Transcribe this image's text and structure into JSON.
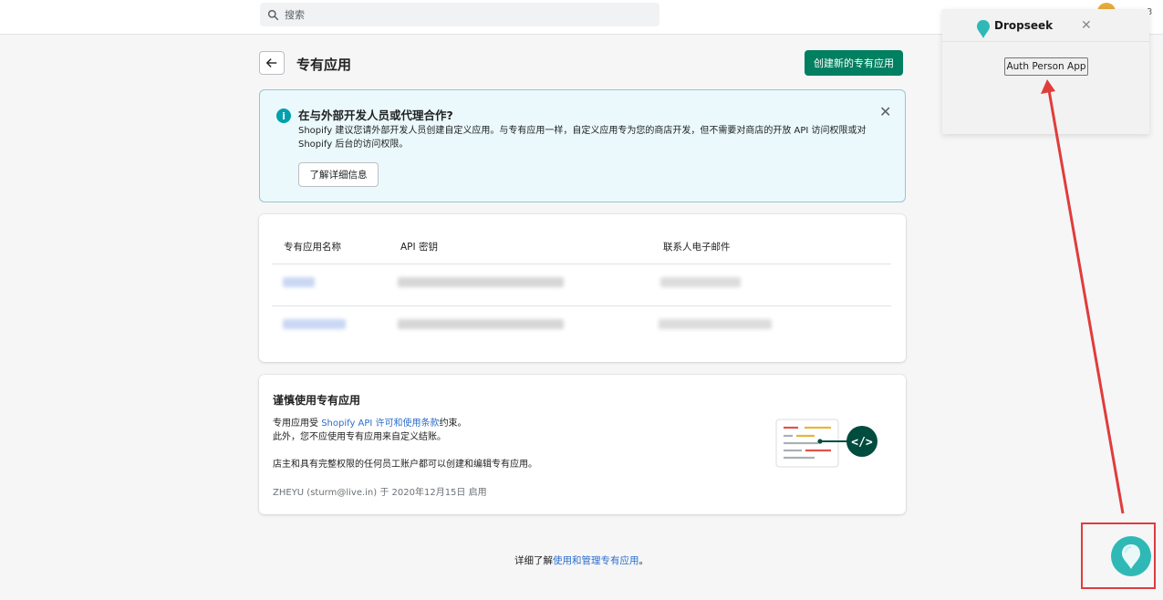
{
  "topbar": {
    "search_placeholder": "搜索",
    "avatar_trail": "3"
  },
  "header": {
    "title": "专有应用",
    "create_button": "创建新的专有应用"
  },
  "banner": {
    "title": "在与外部开发人员或代理合作?",
    "body": "Shopify 建议您请外部开发人员创建自定义应用。与专有应用一样，自定义应用专为您的商店开发，但不需要对商店的开放 API 访问权限或对 Shopify 后台的访问权限。",
    "learn_more": "了解详细信息"
  },
  "apps_table": {
    "headers": [
      "专有应用名称",
      "API 密钥",
      "联系人电子邮件"
    ]
  },
  "caution": {
    "title": "谨慎使用专有应用",
    "line1_prefix": "专用应用受 ",
    "line1_link": "Shopify API 许可和使用条款",
    "line1_suffix": "约束。",
    "line2": "此外，您不应使用专有应用来自定义结账。",
    "line3": "店主和具有完整权限的任何员工账户都可以创建和编辑专有应用。",
    "meta": "ZHEYU (sturm@live.in) 于 2020年12月15日 启用"
  },
  "footer": {
    "prefix": "详细了解",
    "link": "使用和管理专有应用",
    "suffix": "。"
  },
  "extension": {
    "name": "Dropseek",
    "button": "Auth Person App"
  },
  "colors": {
    "primary": "#008060",
    "link": "#2c6ecb",
    "banner_bg": "#ebf9fc",
    "annotation": "#e03c3c",
    "extension_brand": "#2fb9b6"
  }
}
